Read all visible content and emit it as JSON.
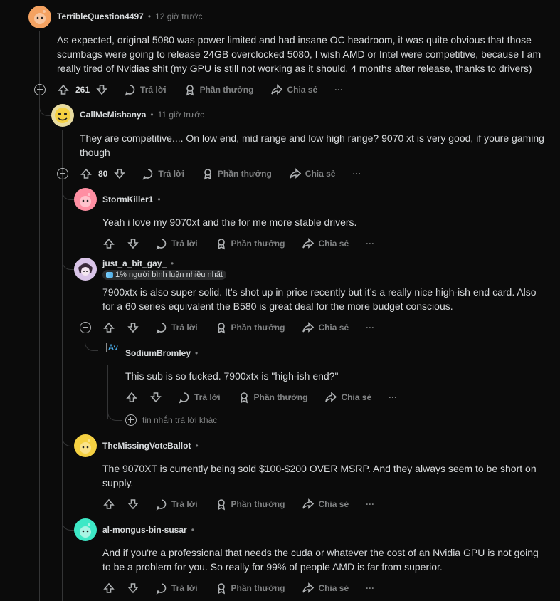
{
  "colors": {
    "background": "#0b0b0b",
    "text": "#d7dadc",
    "muted": "#818384",
    "thread_line": "#343536"
  },
  "actions": {
    "reply": "Trả lời",
    "award": "Phần thưởng",
    "share": "Chia sẻ",
    "more": "···"
  },
  "comments": [
    {
      "author": "TerribleQuestion4497",
      "time": "12 giờ trước",
      "body": "As expected, original 5080 was power limited and had insane OC headroom, it was quite obvious that those scumbags were going to release 24GB overclocked 5080, I wish AMD or Intel were competitive, because I am really tired of Nvidias shit (my GPU is still not working as it should, 4 months after release, thanks to drivers)",
      "score": "261",
      "avatar_color": "#f4a261"
    },
    {
      "author": "CallMeMishanya",
      "time": "11 giờ trước",
      "body": "They are competitive.... On low end, mid range and low high range? 9070 xt is very good, if youre gaming though",
      "score": "80",
      "avatar_color": "#f5d142"
    },
    {
      "author": "StormKiller1",
      "time": "",
      "body": "Yeah i love my 9070xt and the for me more stable drivers.",
      "score": "",
      "avatar_color": "#ff8fa3"
    },
    {
      "author": "just_a_bit_gay_",
      "time": "",
      "flair": "1% người bình luận nhiều nhất",
      "body": "7900xtx is also super solid. It’s shot up in price recently but it’s a really nice high-ish end card. Also for a 60 series equivalent the B580 is great deal for the more budget conscious.",
      "score": "",
      "avatar_color": "#d9c4e8"
    },
    {
      "author": "SodiumBromley",
      "time": "",
      "avatar_alt": "Av",
      "body": "This sub is so fucked. 7900xtx is \"high-ish end?\"",
      "score": ""
    },
    {
      "author": "TheMissingVoteBallot",
      "time": "",
      "body": "The 9070XT is currently being sold $100-$200 OVER MSRP. And they always seem to be short on supply.",
      "score": "",
      "avatar_color": "#f5d142"
    },
    {
      "author": "al-mongus-bin-susar",
      "time": "",
      "body": "And if you're a professional that needs the cuda or whatever the cost of an Nvidia GPU is not going to be a problem for you. So really for 99% of people AMD is far from superior.",
      "score": "",
      "avatar_color": "#3de8c6"
    }
  ],
  "more_replies": "tin nhắn trả lời khác"
}
